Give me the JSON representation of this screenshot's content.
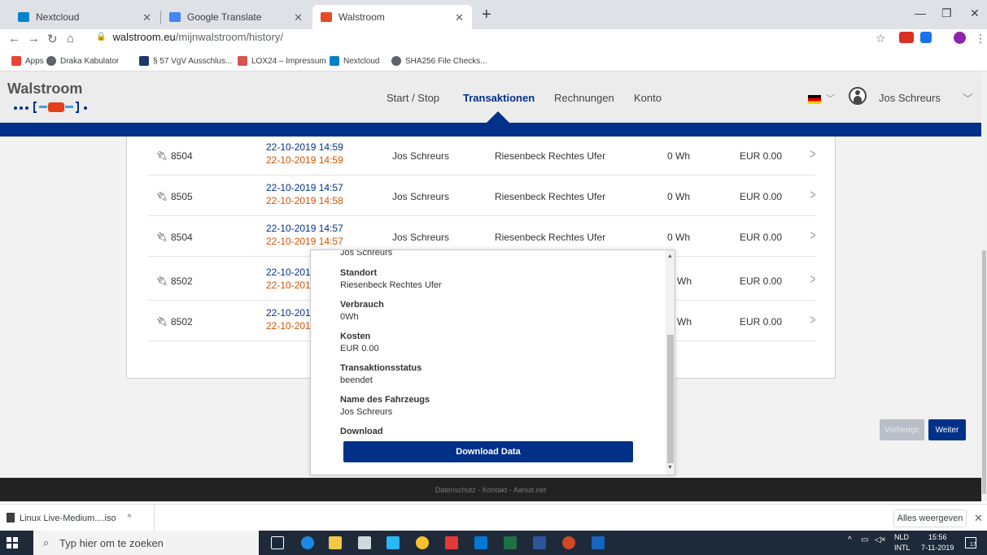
{
  "tabs": [
    {
      "title": "Nextcloud",
      "favicon_color": "#0082c9"
    },
    {
      "title": "Google Translate",
      "favicon_color": "#4285f4"
    },
    {
      "title": "Walstroom",
      "favicon_color": "#e34c26"
    }
  ],
  "address": {
    "domain": "walstroom.eu",
    "path": "/mijnwalstroom/history/"
  },
  "bookmarks": [
    {
      "label": "Apps",
      "color": "#ea4335"
    },
    {
      "label": "Draka Kabulator",
      "color": "#5f6368"
    },
    {
      "label": "§ 57 VgV Ausschlus...",
      "color": "#1a3a6b"
    },
    {
      "label": "LOX24 – Impressum",
      "color": "#d9534f"
    },
    {
      "label": "Nextcloud",
      "color": "#0082c9"
    },
    {
      "label": "SHA256 File Checks...",
      "color": "#5f6368"
    }
  ],
  "app": {
    "logo": "Walstroom",
    "nav": [
      "Start / Stop",
      "Transaktionen",
      "Rechnungen",
      "Konto"
    ],
    "active_nav": "Transaktionen",
    "user": "Jos Schreurs",
    "accent": "#003189"
  },
  "transactions": [
    {
      "id": "8504",
      "start": "22-10-2019 14:59",
      "end": "22-10-2019 14:59",
      "user": "Jos Schreurs",
      "location": "Riesenbeck Rechtes Ufer",
      "energy": "0 Wh",
      "cost": "EUR 0.00"
    },
    {
      "id": "8505",
      "start": "22-10-2019 14:57",
      "end": "22-10-2019 14:58",
      "user": "Jos Schreurs",
      "location": "Riesenbeck Rechtes Ufer",
      "energy": "0 Wh",
      "cost": "EUR 0.00"
    },
    {
      "id": "8504",
      "start": "22-10-2019 14:57",
      "end": "22-10-2019 14:57",
      "user": "Jos Schreurs",
      "location": "Riesenbeck Rechtes Ufer",
      "energy": "0 Wh",
      "cost": "EUR 0.00"
    },
    {
      "id": "8502",
      "start": "22-10-201",
      "end": "22-10-201",
      "user": "",
      "location": "",
      "energy": "Wh",
      "cost": "EUR 0.00"
    },
    {
      "id": "8502",
      "start": "22-10-201",
      "end": "22-10-201",
      "user": "",
      "location": "",
      "energy": "Wh",
      "cost": "EUR 0.00"
    }
  ],
  "pagination": {
    "prev": "Vorherige",
    "next": "Weiter"
  },
  "footer": "Datenschutz - Kontakt - Aanuit.net",
  "modal": {
    "top_value": "Jos Schreurs",
    "fields": [
      {
        "label": "Standort",
        "value": "Riesenbeck Rechtes Ufer"
      },
      {
        "label": "Verbrauch",
        "value": "0Wh"
      },
      {
        "label": "Kosten",
        "value": "EUR 0.00"
      },
      {
        "label": "Transaktionsstatus",
        "value": "beendet"
      },
      {
        "label": "Name des Fahrzeugs",
        "value": "Jos Schreurs"
      }
    ],
    "download_label": "Download",
    "download_button": "Download Data"
  },
  "download_bar": {
    "file": "Linux Live-Medium....iso",
    "show_all": "Alles weergeven"
  },
  "taskbar": {
    "search_placeholder": "Typ hier om te zoeken",
    "lang1": "NLD",
    "lang2": "INTL",
    "time": "15:56",
    "date": "7-11-2019",
    "notifications": "17"
  }
}
